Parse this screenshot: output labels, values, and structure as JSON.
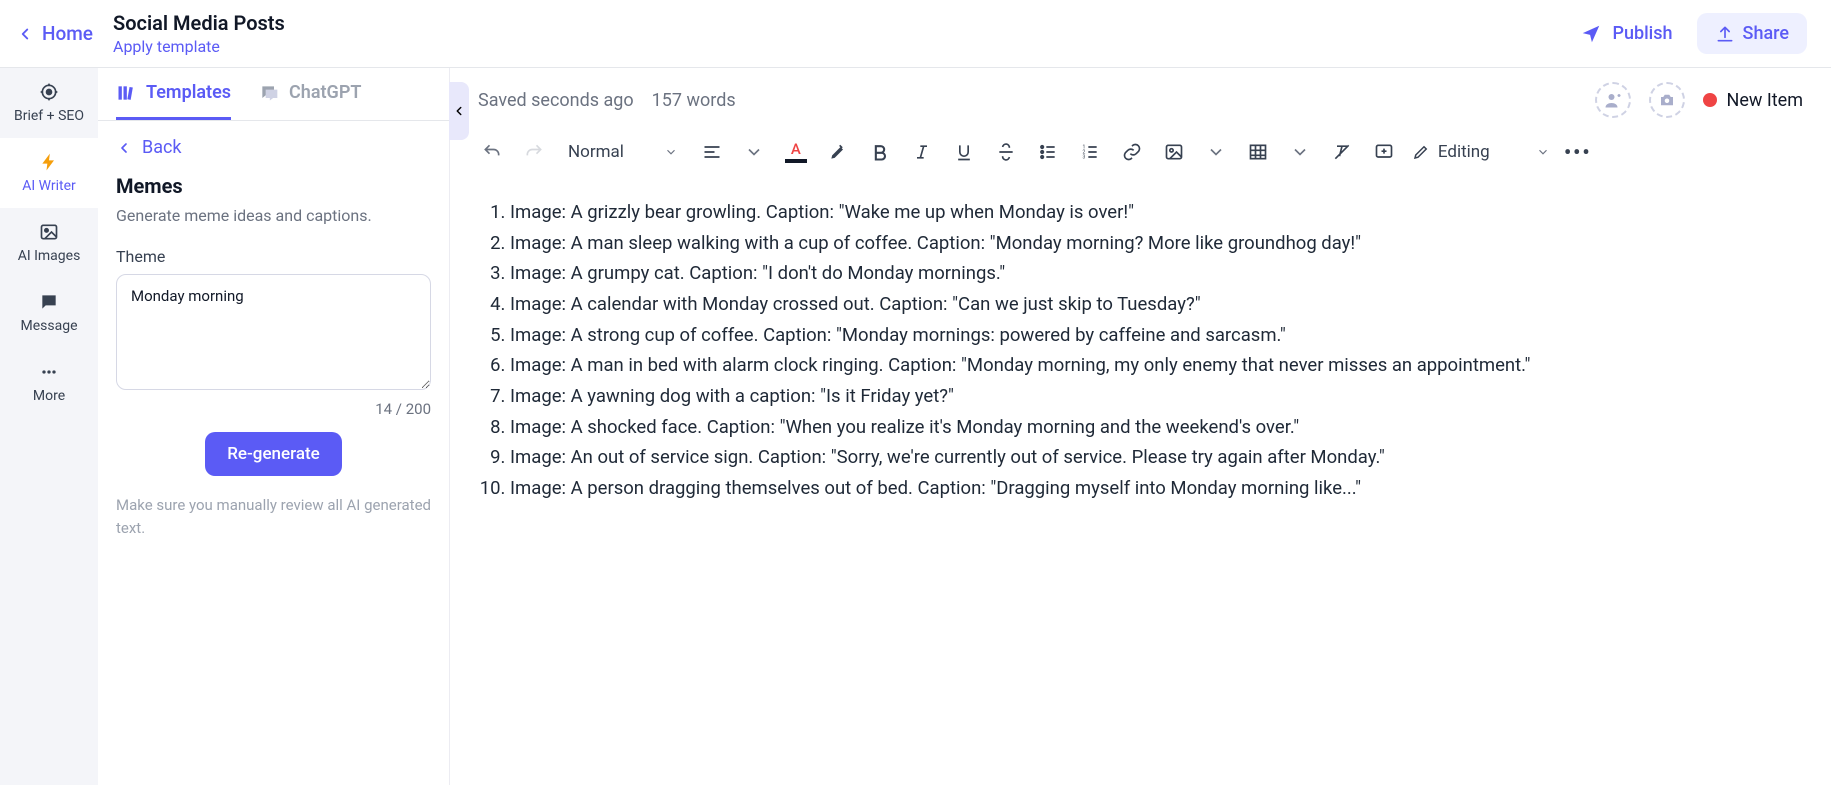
{
  "header": {
    "home": "Home",
    "title": "Social Media Posts",
    "apply_template": "Apply template",
    "publish": "Publish",
    "share": "Share"
  },
  "sidenav": {
    "items": [
      {
        "id": "brief-seo",
        "label": "Brief + SEO"
      },
      {
        "id": "ai-writer",
        "label": "AI Writer"
      },
      {
        "id": "ai-images",
        "label": "AI Images"
      },
      {
        "id": "message",
        "label": "Message"
      },
      {
        "id": "more",
        "label": "More"
      }
    ]
  },
  "panel": {
    "tabs": {
      "templates": "Templates",
      "chatgpt": "ChatGPT"
    },
    "back": "Back",
    "heading": "Memes",
    "sub": "Generate meme ideas and captions.",
    "theme_label": "Theme",
    "theme_value": "Monday morning",
    "char_count": "14 / 200",
    "regenerate": "Re-generate",
    "disclaimer": "Make sure you manually review all AI generated text."
  },
  "status": {
    "saved": "Saved seconds ago",
    "words": "157 words",
    "new_item": "New Item"
  },
  "toolbar": {
    "format": "Normal",
    "editing": "Editing"
  },
  "document": {
    "items": [
      "Image: A grizzly bear growling. Caption: \"Wake me up when Monday is over!\"",
      "Image: A man sleep walking with a cup of coffee. Caption: \"Monday morning? More like groundhog day!\"",
      "Image: A grumpy cat. Caption: \"I don't do Monday mornings.\"",
      "Image: A calendar with Monday crossed out. Caption: \"Can we just skip to Tuesday?\"",
      "Image: A strong cup of coffee. Caption: \"Monday mornings: powered by caffeine and sarcasm.\"",
      "Image: A man in bed with alarm clock ringing. Caption: \"Monday morning, my only enemy that never misses an appointment.\"",
      "Image: A yawning dog with a caption: \"Is it Friday yet?\"",
      "Image: A shocked face. Caption: \"When you realize it's Monday morning and the weekend's over.\"",
      "Image: An out of service sign. Caption: \"Sorry, we're currently out of service. Please try again after Monday.\"",
      "Image: A person dragging themselves out of bed. Caption: \"Dragging myself into Monday morning like...\""
    ]
  }
}
